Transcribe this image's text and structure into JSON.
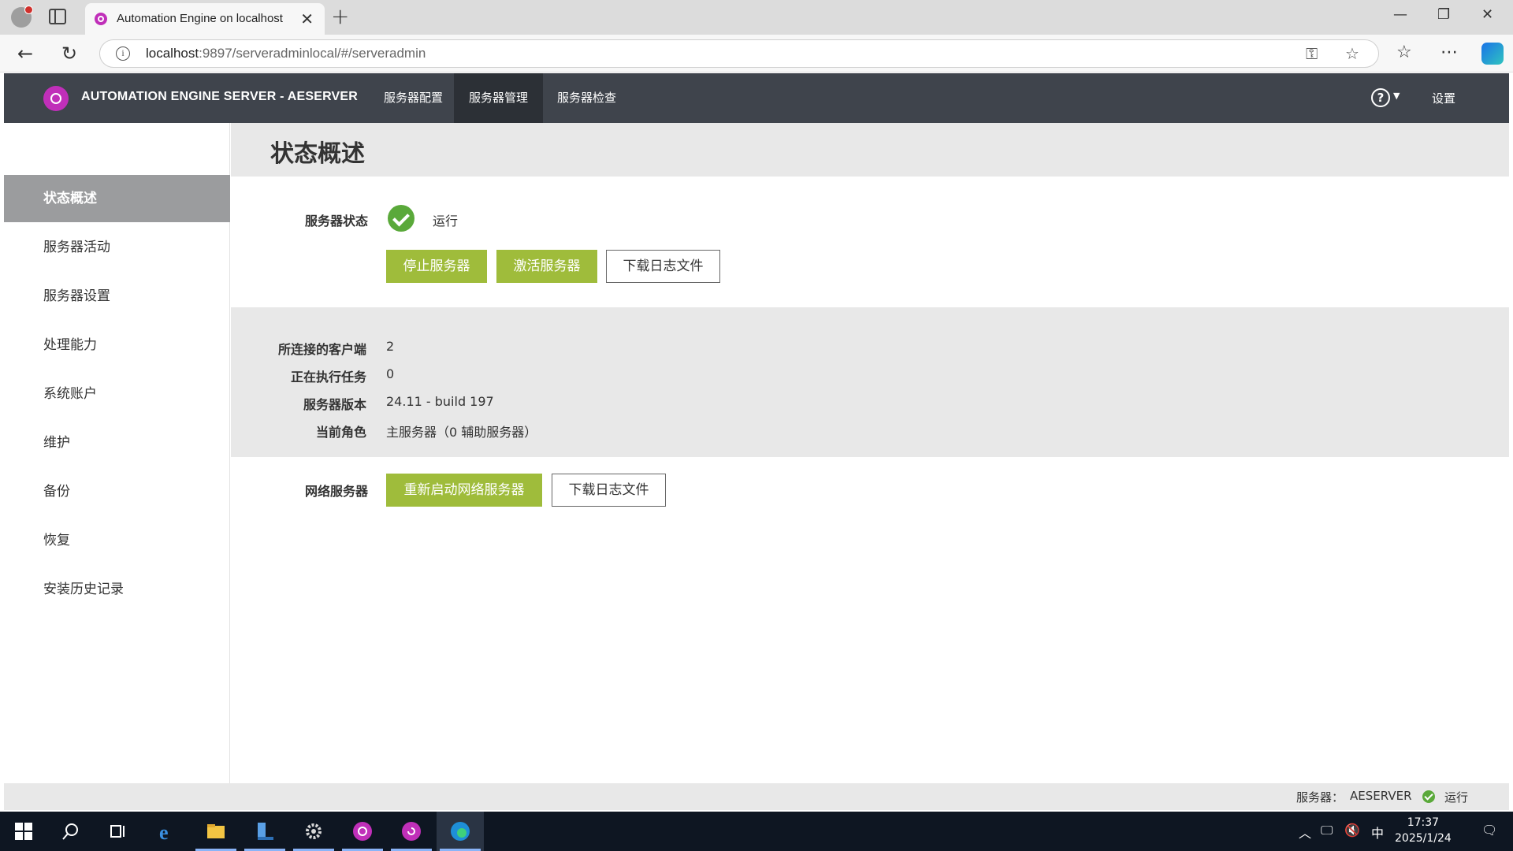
{
  "browser": {
    "tab_title": "Automation Engine on localhost",
    "tab_close": "✕",
    "new_tab": "+",
    "url_host": "localhost",
    "url_rest": ":9897/serveradminlocal/#/serveradmin",
    "window_controls": [
      "—",
      "❐",
      "✕"
    ]
  },
  "header": {
    "brand": "AUTOMATION ENGINE SERVER - AESERVER",
    "menu": [
      {
        "label": "服务器配置",
        "active": false
      },
      {
        "label": "服务器管理",
        "active": true
      },
      {
        "label": "服务器检查",
        "active": false
      }
    ],
    "help": "?",
    "settings": "设置"
  },
  "sidebar": {
    "items": [
      {
        "label": "状态概述",
        "active": true
      },
      {
        "label": "服务器活动",
        "active": false
      },
      {
        "label": "服务器设置",
        "active": false
      },
      {
        "label": "处理能力",
        "active": false
      },
      {
        "label": "系统账户",
        "active": false
      },
      {
        "label": "维护",
        "active": false
      },
      {
        "label": "备份",
        "active": false
      },
      {
        "label": "恢复",
        "active": false
      },
      {
        "label": "安装历史记录",
        "active": false
      }
    ]
  },
  "main": {
    "title": "状态概述",
    "server_status": {
      "label": "服务器状态",
      "value": "运行",
      "buttons": {
        "stop": "停止服务器",
        "activate": "激活服务器",
        "download_log": "下载日志文件"
      }
    },
    "info": [
      {
        "label": "所连接的客户端",
        "value": "2"
      },
      {
        "label": "正在执行任务",
        "value": "0"
      },
      {
        "label": "服务器版本",
        "value": "24.11 - build 197"
      },
      {
        "label": "当前角色",
        "value": "主服务器（0 辅助服务器）"
      }
    ],
    "web_server": {
      "label": "网络服务器",
      "buttons": {
        "restart": "重新启动网络服务器",
        "download_log": "下载日志文件"
      }
    }
  },
  "footer": {
    "label": "服务器：",
    "server": "AESERVER",
    "state": "运行"
  },
  "taskbar": {
    "clock_time": "17:37",
    "clock_date": "2025/1/24",
    "ime": "中",
    "colors": {
      "accent_green": "#9fbc3b",
      "status_green": "#5aa93a",
      "header": "#3f444c",
      "brand": "#c02fb9"
    }
  }
}
